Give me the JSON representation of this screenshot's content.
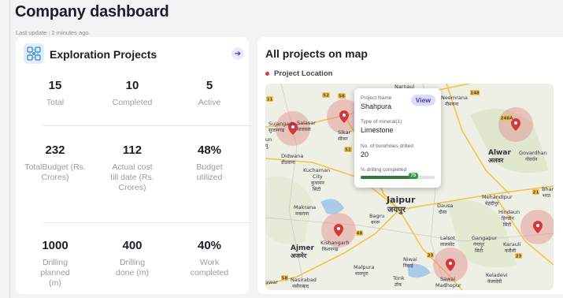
{
  "page": {
    "title": "Company dashboard",
    "last_update": "Last update : 2 minutes ago."
  },
  "exploration": {
    "title": "Exploration Projects",
    "icon": "exploration-icon",
    "rows": [
      [
        {
          "value": "15",
          "label": "Total"
        },
        {
          "value": "10",
          "label": "Completed"
        },
        {
          "value": "5",
          "label": "Active"
        }
      ],
      [
        {
          "value": "232",
          "label": "TotalBudget (Rs. Crores)"
        },
        {
          "value": "112",
          "label": "Actual cost till date (Rs. Crores)"
        },
        {
          "value": "48%",
          "label": "Budget utilized"
        }
      ],
      [
        {
          "value": "1000",
          "label": "Drilling planned (m)"
        },
        {
          "value": "400",
          "label": "Drilling done (m)"
        },
        {
          "value": "40%",
          "label": "Work completed"
        }
      ]
    ]
  },
  "map_card": {
    "title": "All projects on map",
    "legend": "Project Location",
    "colors": {
      "marker": "#d23a3a",
      "halo": "#e58a8a",
      "road": "#f2c24a",
      "water": "#a9cbe8"
    },
    "labels": {
      "namaul": "Narnaul",
      "neemrana": "Neemrana",
      "neemrana_local": "नीमराना",
      "sujangarh": "Sujangarh",
      "sujangarh_local": "सुजानगढ़",
      "salasar": "Salasar",
      "salasar_local": "सालासर",
      "sikar": "Sikar",
      "sikar_local": "सीकर",
      "un": "un",
      "un_local": "पूं",
      "didwana": "Didwana",
      "didwana_local": "डीडवाना",
      "kuchaman": "Kuchaman",
      "kuchaman_city": "City",
      "kuchaman_local": "कुचामन",
      "kuchaman_local2": "सिटी",
      "makrana": "Makrana",
      "makrana_local": "मकराना",
      "alwar": "Alwar",
      "alwar_local": "अलवर",
      "govardhan": "Govardhan",
      "govardhan_local": "गोवर्धन",
      "bhara": "Bhara",
      "bhara_local": "भरत",
      "mehandipur": "Mehandipur",
      "mehandipur_local": "मेहंदीपुर",
      "hindaun": "Hindaun",
      "hindaun_local": "हिण्डौन",
      "hindaun_local2": "सिटी",
      "jaipur": "Jaipur",
      "jaipur_local": "जयपुर",
      "dausa": "Dausa",
      "dausa_local": "दौसा",
      "bagru": "Bagru",
      "bagru_local": "बगरू",
      "ajmer": "Ajmer",
      "ajmer_local": "अजमेर",
      "kishangarh": "Kishangarh",
      "kishangarh_local": "किशनगढ़",
      "lalsot": "Lalsot",
      "lalsot_local": "लालसोट",
      "gangapur": "Gangapur",
      "gangapur_local": "गंगापुर",
      "gangapur_local2": "सिटी",
      "karauli": "Karauli",
      "karauli_local": "करौली",
      "niwai": "Niwai",
      "niwai_local": "निवाई",
      "malpura": "Malpura",
      "malpura_local": "मालपुरा",
      "tonk": "Tonk",
      "tonk_local": "टोंक",
      "nasirabad": "Nasirabad",
      "nasirabad_local": "नसीराबाद",
      "sawai": "Sawai",
      "madhopur": "Madhopur",
      "keladevi": "Keladevi",
      "keladevi_local": "केलादेवी",
      "awar": "awar",
      "shield_52": "52",
      "shield_58": "58",
      "shield_11": "11",
      "shield_248a": "248A",
      "shield_21": "21",
      "shield_23": "23",
      "shield_48": "48",
      "shield_148": "148"
    },
    "popup": {
      "project_name_label": "Project Name",
      "project_name": "Shahpura",
      "view_label": "View",
      "mineral_label": "Type of mineral(1)",
      "mineral": "Limestone",
      "boreholes_label": "No. of boreholes drilled",
      "boreholes": "20",
      "drilling_label": "% drilling completed",
      "drilling_percent": "75",
      "drilling_fraction": 0.75
    }
  }
}
